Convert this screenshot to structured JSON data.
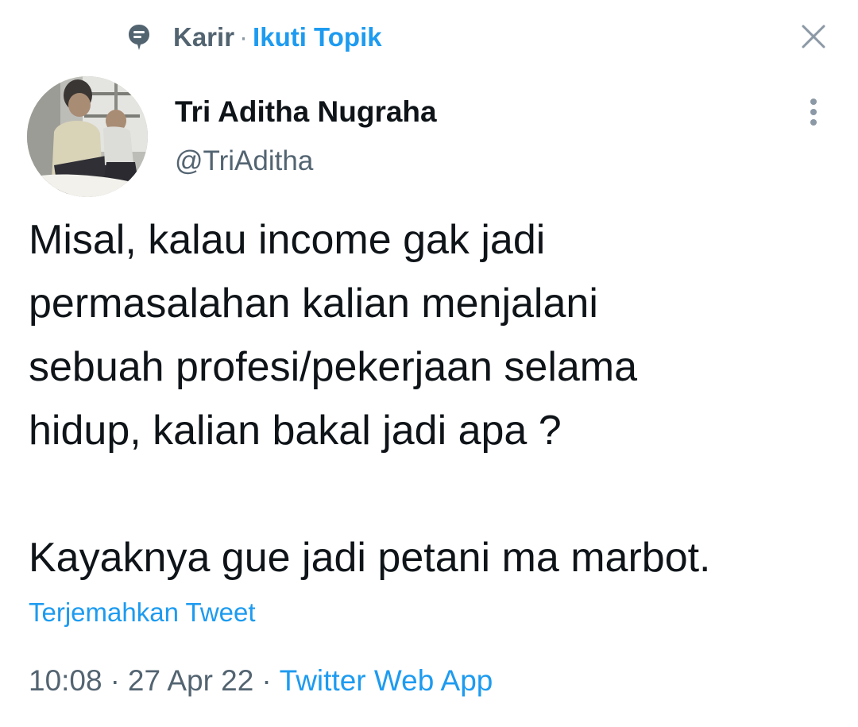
{
  "topic": {
    "icon": "topic-bubble-icon",
    "name": "Karir",
    "separator": "·",
    "follow_label": "Ikuti Topik"
  },
  "close": {
    "icon": "close-icon"
  },
  "author": {
    "avatar": "avatar-photo",
    "name": "Tri Aditha Nugraha",
    "handle": "@TriAditha"
  },
  "more": {
    "icon": "more-vertical-icon"
  },
  "tweet": {
    "paragraph1": "Misal, kalau income gak jadi\npermasalahan kalian menjalani\nsebuah profesi/pekerjaan selama\nhidup, kalian bakal jadi apa ?",
    "paragraph2": "Kayaknya gue jadi petani ma marbot."
  },
  "translate_label": "Terjemahkan Tweet",
  "meta": {
    "time": "10:08",
    "separator": "·",
    "date": "27 Apr 22",
    "source": "Twitter Web App"
  },
  "colors": {
    "text": "#0f1419",
    "secondary": "#536471",
    "link": "#1d9bf0"
  }
}
